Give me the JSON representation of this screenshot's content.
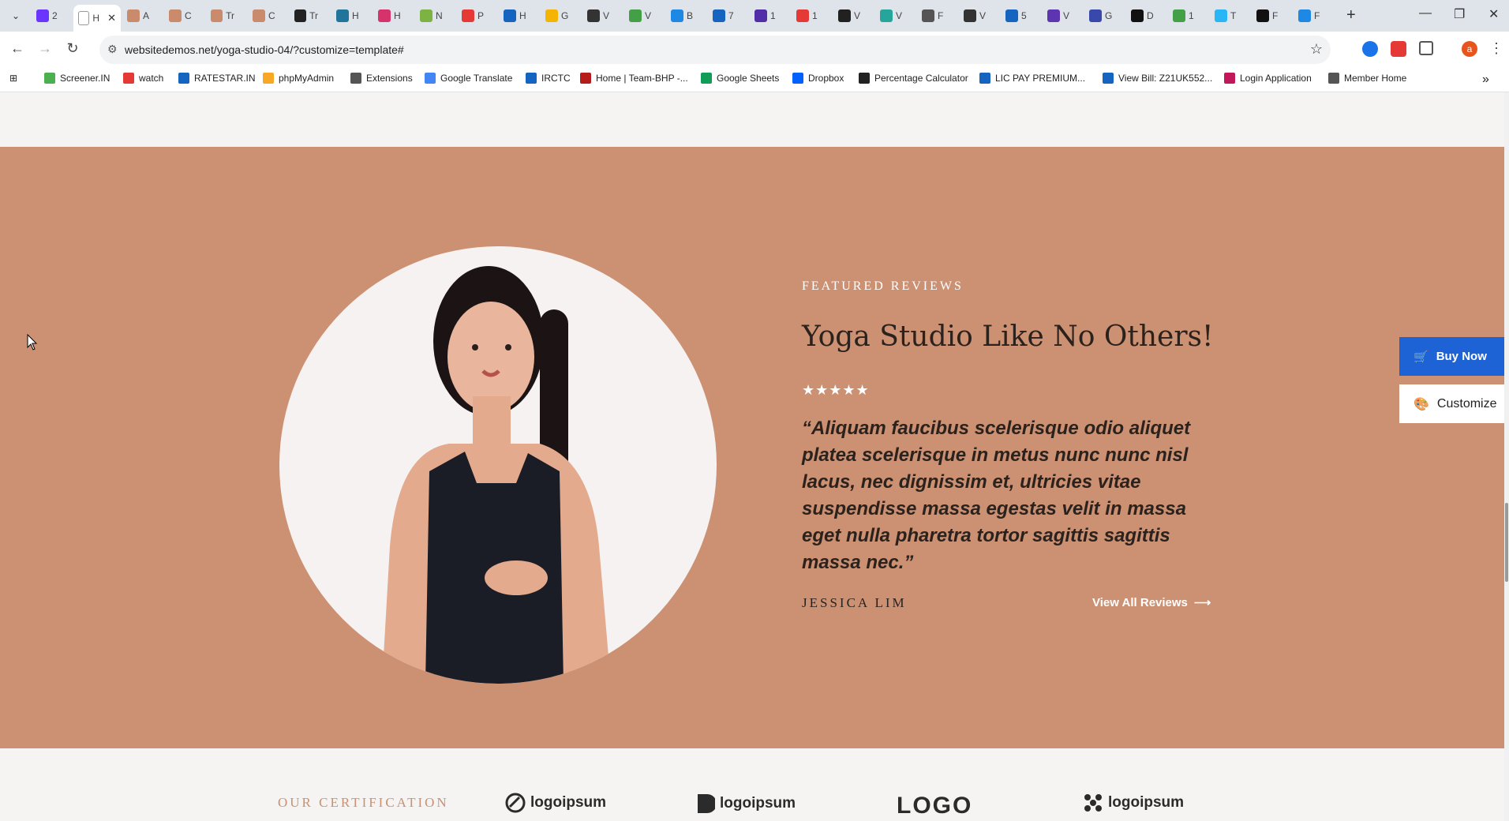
{
  "browser": {
    "tabs": [
      {
        "letter": "2",
        "color": "#6a35ff"
      },
      {
        "letter": "H",
        "color": "#ffffff",
        "active": true
      },
      {
        "letter": "A",
        "color": "#c98b6b"
      },
      {
        "letter": "C",
        "color": "#c98b6b"
      },
      {
        "letter": "Tr",
        "color": "#c98b6b"
      },
      {
        "letter": "C",
        "color": "#c98b6b"
      },
      {
        "letter": "Tr",
        "color": "#222222"
      },
      {
        "letter": "H",
        "color": "#21759b"
      },
      {
        "letter": "H",
        "color": "#d6336c"
      },
      {
        "letter": "N",
        "color": "#7cb342"
      },
      {
        "letter": "P",
        "color": "#e53935"
      },
      {
        "letter": "H",
        "color": "#1565c0"
      },
      {
        "letter": "G",
        "color": "#f4b400"
      },
      {
        "letter": "V",
        "color": "#333333"
      },
      {
        "letter": "V",
        "color": "#43a047"
      },
      {
        "letter": "B",
        "color": "#1e88e5"
      },
      {
        "letter": "7",
        "color": "#1565c0"
      },
      {
        "letter": "1",
        "color": "#512da8"
      },
      {
        "letter": "1",
        "color": "#e53935"
      },
      {
        "letter": "V",
        "color": "#212121"
      },
      {
        "letter": "V",
        "color": "#26a69a"
      },
      {
        "letter": "F",
        "color": "#555555"
      },
      {
        "letter": "V",
        "color": "#333333"
      },
      {
        "letter": "5",
        "color": "#1565c0"
      },
      {
        "letter": "V",
        "color": "#5e35b1"
      },
      {
        "letter": "G",
        "color": "#3949ab"
      },
      {
        "letter": "D",
        "color": "#111111"
      },
      {
        "letter": "1",
        "color": "#43a047"
      },
      {
        "letter": "T",
        "color": "#29b6f6"
      },
      {
        "letter": "F",
        "color": "#111111"
      },
      {
        "letter": "F",
        "color": "#1e88e5"
      }
    ],
    "active_tab_close": "✕",
    "new_tab": "+",
    "url": "websitedemos.net/yoga-studio-04/?customize=template#",
    "bookmarks": [
      {
        "label": "Screener.IN",
        "color": "#4caf50"
      },
      {
        "label": "watch",
        "color": "#e53935"
      },
      {
        "label": "RATESTAR.IN",
        "color": "#1565c0"
      },
      {
        "label": "phpMyAdmin",
        "color": "#f9a825"
      },
      {
        "label": "Extensions",
        "color": "#555555"
      },
      {
        "label": "Google Translate",
        "color": "#4285f4"
      },
      {
        "label": "IRCTC",
        "color": "#1565c0"
      },
      {
        "label": "Home | Team-BHP -...",
        "color": "#b71c1c"
      },
      {
        "label": "Google Sheets",
        "color": "#0f9d58"
      },
      {
        "label": "Dropbox",
        "color": "#0061ff"
      },
      {
        "label": "Percentage Calculator",
        "color": "#222222"
      },
      {
        "label": "LIC PAY PREMIUM...",
        "color": "#1565c0"
      },
      {
        "label": "View Bill: Z21UK552...",
        "color": "#1565c0"
      },
      {
        "label": "Login Application",
        "color": "#c2185b"
      },
      {
        "label": "Member Home",
        "color": "#555555"
      }
    ],
    "profile_initial": "a"
  },
  "reviews": {
    "kicker": "FEATURED REVIEWS",
    "title": "Yoga Studio Like No Others!",
    "stars": "★★★★★",
    "quote": "“Aliquam faucibus scelerisque odio aliquet platea scelerisque in metus nunc nunc nisl lacus, nec dignissim et, ultricies vitae suspendisse massa egestas velit in massa eget nulla pharetra tortor sagittis sagittis massa nec.”",
    "author": "JESSICA LIM",
    "view_all": "View All Reviews",
    "arrow": "⟶"
  },
  "sidebar_actions": {
    "buy_now": "Buy Now",
    "customize": "Customize"
  },
  "certification": {
    "label": "OUR CERTIFICATION",
    "logos": [
      "logoipsum",
      "logoipsum",
      "LOGO",
      "logoipsum"
    ]
  },
  "colors": {
    "section_bg": "#cc9172",
    "accent_blue": "#1e63d6",
    "heading_dark": "#2b211d"
  }
}
